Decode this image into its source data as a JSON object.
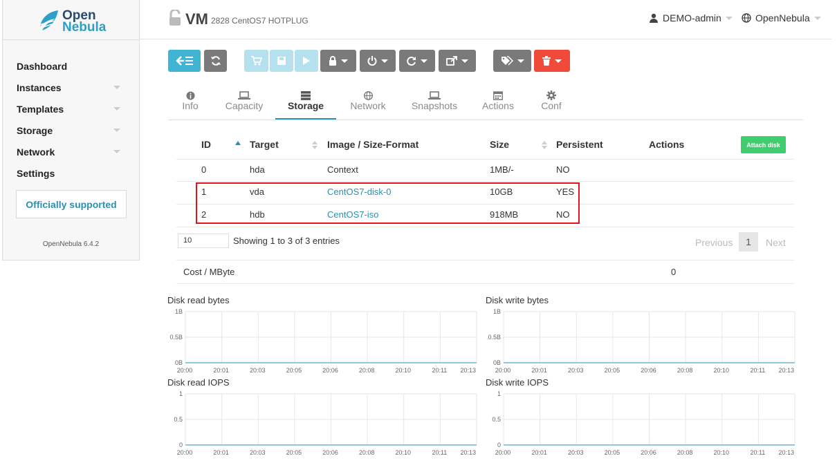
{
  "brand": {
    "line1": "Open",
    "line2": "Nebula",
    "version": "OpenNebula 6.4.2"
  },
  "sidebar": {
    "items": [
      {
        "label": "Dashboard",
        "has_caret": false
      },
      {
        "label": "Instances",
        "has_caret": true
      },
      {
        "label": "Templates",
        "has_caret": true
      },
      {
        "label": "Storage",
        "has_caret": true
      },
      {
        "label": "Network",
        "has_caret": true
      },
      {
        "label": "Settings",
        "has_caret": false
      }
    ],
    "support": "Officially supported"
  },
  "header": {
    "title": "VM",
    "subtitle": "2828 CentOS7 HOTPLUG",
    "user": "DEMO-admin",
    "zone": "OpenNebula"
  },
  "tabs": [
    {
      "label": "Info",
      "icon": "info-icon"
    },
    {
      "label": "Capacity",
      "icon": "laptop-icon"
    },
    {
      "label": "Storage",
      "icon": "server-icon",
      "active": true
    },
    {
      "label": "Network",
      "icon": "globe-icon"
    },
    {
      "label": "Snapshots",
      "icon": "laptop-icon"
    },
    {
      "label": "Actions",
      "icon": "calendar-icon"
    },
    {
      "label": "Conf",
      "icon": "gear-icon"
    }
  ],
  "table": {
    "headers": {
      "id": "ID",
      "target": "Target",
      "image": "Image / Size-Format",
      "size": "Size",
      "persistent": "Persistent",
      "actions": "Actions"
    },
    "attach_label": "Attach disk",
    "rows": [
      {
        "id": "0",
        "target": "hda",
        "image": "Context",
        "size": "1MB/-",
        "persistent": "NO"
      },
      {
        "id": "1",
        "target": "vda",
        "image": "CentOS7-disk-0",
        "size": "10GB",
        "persistent": "YES"
      },
      {
        "id": "2",
        "target": "hdb",
        "image": "CentOS7-iso",
        "size": "918MB",
        "persistent": "NO"
      }
    ],
    "page_size": "10",
    "showing": "Showing 1 to 3 of 3 entries",
    "previous": "Previous",
    "page": "1",
    "next": "Next"
  },
  "cost": {
    "label": "Cost / MByte",
    "value": "0"
  },
  "colors": {
    "accent": "#2b8fb0",
    "line": "#8fc7dc",
    "attach": "#3fcd6e",
    "danger": "#ef4a3a",
    "highlight": "#e2131b"
  },
  "chart_data": [
    {
      "type": "line",
      "title": "Disk read bytes",
      "y_ticks": [
        "1B",
        "0.5B",
        "0B"
      ],
      "x": [
        "20:00",
        "20:01",
        "20:03",
        "20:05",
        "20:06",
        "20:08",
        "20:10",
        "20:11",
        "20:13"
      ],
      "series": [
        {
          "values": [
            0,
            0,
            0,
            0,
            0,
            0,
            0,
            0,
            0
          ]
        }
      ],
      "ylim": [
        0,
        1
      ]
    },
    {
      "type": "line",
      "title": "Disk write bytes",
      "y_ticks": [
        "1B",
        "0.5B",
        "0B"
      ],
      "x": [
        "20:00",
        "20:01",
        "20:03",
        "20:05",
        "20:06",
        "20:08",
        "20:10",
        "20:11",
        "20:13"
      ],
      "series": [
        {
          "values": [
            0,
            0,
            0,
            0,
            0,
            0,
            0,
            0,
            0
          ]
        }
      ],
      "ylim": [
        0,
        1
      ]
    },
    {
      "type": "line",
      "title": "Disk read IOPS",
      "y_ticks": [
        "1",
        "0.5",
        "0"
      ],
      "x": [
        "20:00",
        "20:01",
        "20:03",
        "20:05",
        "20:06",
        "20:08",
        "20:10",
        "20:11",
        "20:13"
      ],
      "series": [
        {
          "values": [
            0,
            0,
            0,
            0,
            0,
            0,
            0,
            0,
            0
          ]
        }
      ],
      "ylim": [
        0,
        1
      ]
    },
    {
      "type": "line",
      "title": "Disk write IOPS",
      "y_ticks": [
        "1",
        "0.5",
        "0"
      ],
      "x": [
        "20:00",
        "20:01",
        "20:03",
        "20:05",
        "20:06",
        "20:08",
        "20:10",
        "20:11",
        "20:13"
      ],
      "series": [
        {
          "values": [
            0,
            0,
            0,
            0,
            0,
            0,
            0,
            0,
            0
          ]
        }
      ],
      "ylim": [
        0,
        1
      ]
    }
  ]
}
